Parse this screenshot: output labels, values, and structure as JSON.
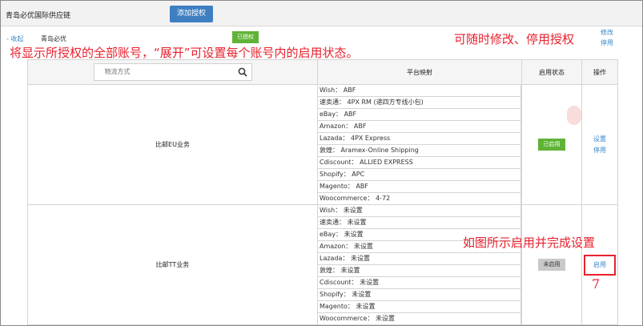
{
  "topbar": {
    "company": "青岛必优国际供应链",
    "add_button": "添加授权"
  },
  "account_group": {
    "collapse": "- 收起",
    "name": "青岛必优",
    "badge": "已授权",
    "actions": [
      "修改",
      "停用"
    ]
  },
  "annotations": {
    "note_top": "将显示所授权的全部账号，“展开”可设置每个账号内的启用状态。",
    "note_right": "可随时修改、停用授权",
    "note_enable": "如图所示启用并完成设置",
    "step_number": "7"
  },
  "table": {
    "search_placeholder": "物流方式",
    "headers": {
      "mapping": "平台映射",
      "status": "启用状态",
      "ops": "操作"
    },
    "rows": [
      {
        "account": "比邮EU业务",
        "mappings": [
          "Wish： ABF",
          "速卖通： 4PX RM (递四方专线小包)",
          "eBay： ABF",
          "Amazon： ABF",
          "Lazada： 4PX Express",
          "敦煌： Aramex-Online Shipping",
          "Cdiscount： ALLIED EXPRESS",
          "Shopify： APC",
          "Magento： ABF",
          "Woocommerce： 4-72"
        ],
        "status": "已启用",
        "ops": [
          "设置",
          "停用"
        ]
      },
      {
        "account": "比邮TT业务",
        "mappings": [
          "Wish： 未设置",
          "速卖通： 未设置",
          "eBay： 未设置",
          "Amazon： 未设置",
          "Lazada： 未设置",
          "敦煌： 未设置",
          "Cdiscount： 未设置",
          "Shopify： 未设置",
          "Magento： 未设置",
          "Woocommerce： 未设置"
        ],
        "status": "未启用",
        "ops": [
          "启用"
        ]
      }
    ]
  },
  "colors": {
    "primary": "#3d7fc1",
    "link": "#3a87c8",
    "success": "#5fb336",
    "annotation": "#e8212e"
  }
}
